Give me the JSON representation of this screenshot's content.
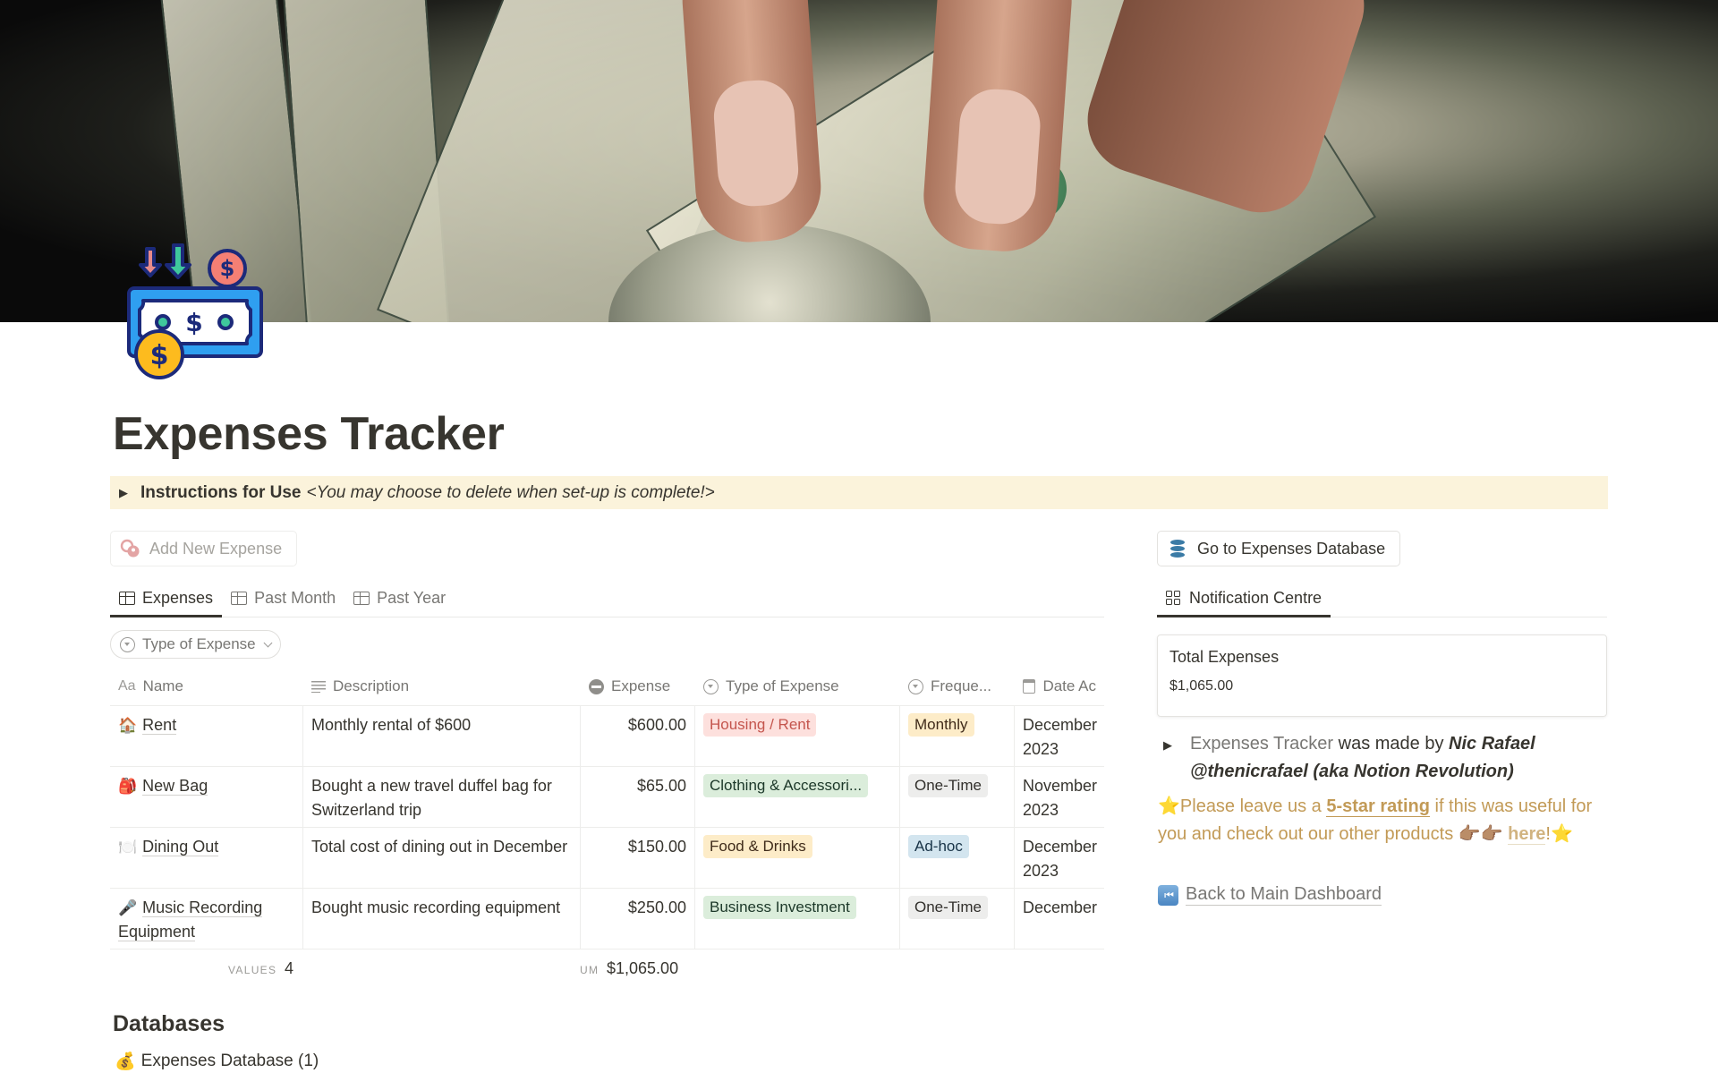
{
  "page": {
    "title": "Expenses Tracker",
    "cover_image": "hand-holding-dollar-bills",
    "icon": "money-bill-coins-icon"
  },
  "callout": {
    "bold": "Instructions for Use",
    "italic": "<You may choose to delete when set-up is complete!>",
    "background": "#fbf3db"
  },
  "add_button": {
    "label": "Add New Expense",
    "icon": "add-expense-icon"
  },
  "views": {
    "tabs": [
      {
        "label": "Expenses",
        "icon": "table-icon",
        "active": true
      },
      {
        "label": "Past Month",
        "icon": "table-icon",
        "active": false
      },
      {
        "label": "Past Year",
        "icon": "table-icon",
        "active": false
      }
    ],
    "filter": {
      "label": "Type of Expense",
      "icon": "select-icon"
    }
  },
  "table": {
    "columns": [
      {
        "label": "Name",
        "icon": "text-title-icon"
      },
      {
        "label": "Description",
        "icon": "text-lines-icon"
      },
      {
        "label": "Expense",
        "icon": "formula-icon"
      },
      {
        "label": "Type of Expense",
        "icon": "select-icon"
      },
      {
        "label": "Freque...",
        "icon": "select-icon"
      },
      {
        "label": "Date Ac",
        "icon": "calendar-icon"
      }
    ],
    "rows": [
      {
        "emoji": "🏠",
        "name": "Rent",
        "description": "Monthly rental of $600",
        "expense": "$600.00",
        "type": {
          "label": "Housing / Rent",
          "bg": "#fde0dd",
          "fg": "#c4554d"
        },
        "frequency": {
          "label": "Monthly",
          "bg": "#fdecc8",
          "fg": "#402c1b"
        },
        "date": "December 2023"
      },
      {
        "emoji": "🎒",
        "name": "New Bag",
        "description": "Bought a new travel duffel bag for Switzerland trip",
        "expense": "$65.00",
        "type": {
          "label": "Clothing & Accessori...",
          "bg": "#dbeddb",
          "fg": "#1c3829"
        },
        "frequency": {
          "label": "One-Time",
          "bg": "#ededec",
          "fg": "#32302c"
        },
        "date": "November 2023"
      },
      {
        "emoji": "🍽️",
        "name": "Dining Out",
        "description": "Total cost of dining out in December",
        "expense": "$150.00",
        "type": {
          "label": "Food & Drinks",
          "bg": "#fdecc8",
          "fg": "#402c1b"
        },
        "frequency": {
          "label": "Ad-hoc",
          "bg": "#d3e5ef",
          "fg": "#183347"
        },
        "date": "December 2023"
      },
      {
        "emoji": "🎤",
        "name": "Music Recording Equipment",
        "description": "Bought music recording equipment",
        "expense": "$250.00",
        "type": {
          "label": "Business Investment",
          "bg": "#dbeddb",
          "fg": "#1c3829"
        },
        "frequency": {
          "label": "One-Time",
          "bg": "#ededec",
          "fg": "#32302c"
        },
        "date": "December"
      }
    ],
    "footer": {
      "count_label": "VALUES",
      "count_value": "4",
      "sum_label": "UM",
      "sum_value": "$1,065.00"
    }
  },
  "databases": {
    "heading": "Databases",
    "items": [
      {
        "emoji": "💰",
        "label": "Expenses Database (1)"
      }
    ]
  },
  "right": {
    "goto_button": {
      "label": "Go to Expenses Database",
      "icon": "database-icon"
    },
    "tab": {
      "label": "Notification Centre",
      "icon": "gallery-icon"
    },
    "card": {
      "title": "Total Expenses",
      "value": "$1,065.00"
    },
    "credit": {
      "grey": "Expenses Tracker",
      "middle": " was made by ",
      "author": "Nic Rafael @thenicrafael (aka Notion Revolution)"
    },
    "rating": {
      "star": "⭐",
      "pre": "Please leave us a ",
      "link": "5-star rating",
      "post": " if this was useful for you and check out our other products 👉🏽👉🏽 ",
      "here": "here",
      "end": "!",
      "accent": "#c29a56"
    },
    "back": {
      "icon": "⏮",
      "label": "Back to Main Dashboard"
    }
  }
}
